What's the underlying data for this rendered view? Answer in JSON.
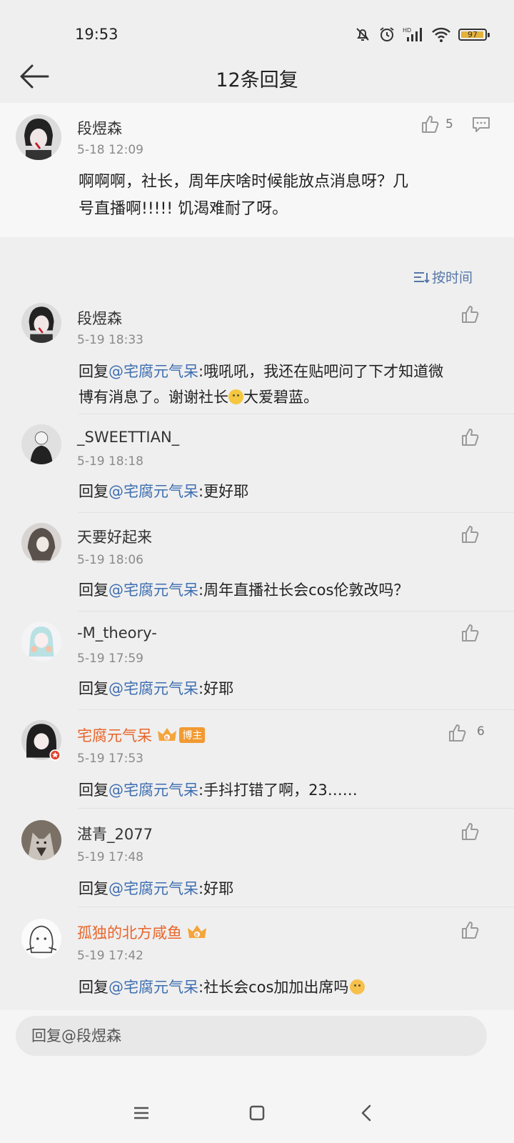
{
  "status": {
    "time": "19:53",
    "battery": "97",
    "battery_level": 0.97,
    "network": "HD"
  },
  "header": {
    "title": "12条回复"
  },
  "main_comment": {
    "author": "段煜森",
    "date": "5-18 12:09",
    "likes": "5",
    "text_line1": "啊啊啊，社长，周年庆啥时候能放点消息呀？几",
    "text_line2": "号直播啊!!!!! 饥渴难耐了呀。"
  },
  "sort": {
    "label": "按时间"
  },
  "replies": [
    {
      "author": "段煜森",
      "date": "5-19 18:33",
      "prefix": "回复",
      "mention": "@宅腐元气呆",
      "text_line1": ":哦吼吼，我还在贴吧问了下才知道微",
      "text_line2a": "博有消息了。谢谢社长",
      "text_line2b": "大爱碧蓝。"
    },
    {
      "author": "_SWEETTIAN_",
      "date": "5-19 18:18",
      "prefix": "回复",
      "mention": "@宅腐元气呆",
      "text": ":更好耶"
    },
    {
      "author": "天要好起来",
      "date": "5-19 18:06",
      "prefix": "回复",
      "mention": "@宅腐元气呆",
      "text": ":周年直播社长会cos伦敦改吗？"
    },
    {
      "author": "-M_theory-",
      "date": "5-19 17:59",
      "prefix": "回复",
      "mention": "@宅腐元气呆",
      "text": ":好耶"
    },
    {
      "author": "宅腐元气呆",
      "author_badge": "博主",
      "date": "5-19 17:53",
      "likes": "6",
      "prefix": "回复",
      "mention": "@宅腐元气呆",
      "text": ":手抖打错了啊，23……"
    },
    {
      "author": "湛青_2077",
      "date": "5-19 17:48",
      "prefix": "回复",
      "mention": "@宅腐元气呆",
      "text": ":好耶"
    },
    {
      "author": "孤独的北方咸鱼",
      "date": "5-19 17:42",
      "prefix": "回复",
      "mention": "@宅腐元气呆",
      "text": ":社长会cos加加出席吗"
    }
  ],
  "input": {
    "placeholder": "回复@段煜森"
  },
  "colors": {
    "mention": "#3e6eb0",
    "vip_name": "#e8652a",
    "badge": "#f19a32",
    "sort": "#5576a8"
  }
}
